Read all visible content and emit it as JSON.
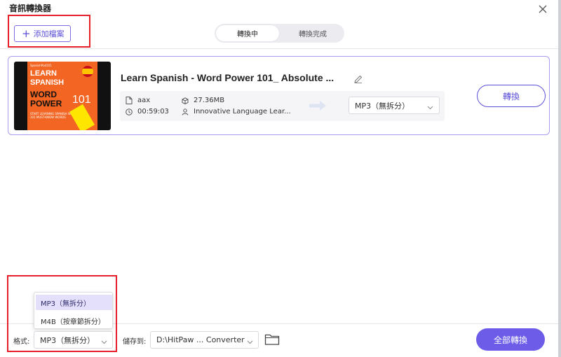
{
  "app": {
    "title": "音訊轉換器"
  },
  "toolbar": {
    "add_label": "添加檔案"
  },
  "tabs": [
    {
      "label": "轉換中",
      "active": true
    },
    {
      "label": "轉換完成",
      "active": false
    }
  ],
  "file": {
    "title": "Learn Spanish - Word Power 101_ Absolute ...",
    "format": "aax",
    "duration": "00:59:03",
    "size": "27.36MB",
    "author": "Innovative Language Lear...",
    "output_format": "MP3（無拆分）",
    "convert_label": "轉換",
    "cover": {
      "brand": "SpanishPod101",
      "line1": "LEARN",
      "line2": "SPANISH",
      "line3": "WORD",
      "line4": "POWER",
      "number": "101",
      "tagline": "START LEARNING SPANISH WITH THE 101 MUST-KNOW WORDS"
    }
  },
  "bottom": {
    "format_label": "格式:",
    "format_value": "MP3（無拆分）",
    "options": [
      "MP3（無拆分）",
      "M4B（按章節拆分）"
    ],
    "save_label": "儲存到:",
    "save_path": "D:\\HitPaw ... Converter",
    "convert_all_label": "全部轉換"
  },
  "colors": {
    "accent": "#6c5ce7",
    "highlight": "#e5202a",
    "selected_option_bg": "#e4e0fb"
  },
  "icons": {
    "close": "close-icon",
    "add": "plus-icon",
    "edit": "pencil-icon",
    "file": "file-icon",
    "clock": "clock-icon",
    "size": "cube-icon",
    "author": "person-icon",
    "chevron": "chevron-down-icon",
    "folder": "folder-icon",
    "arrow": "arrow-right-icon"
  }
}
